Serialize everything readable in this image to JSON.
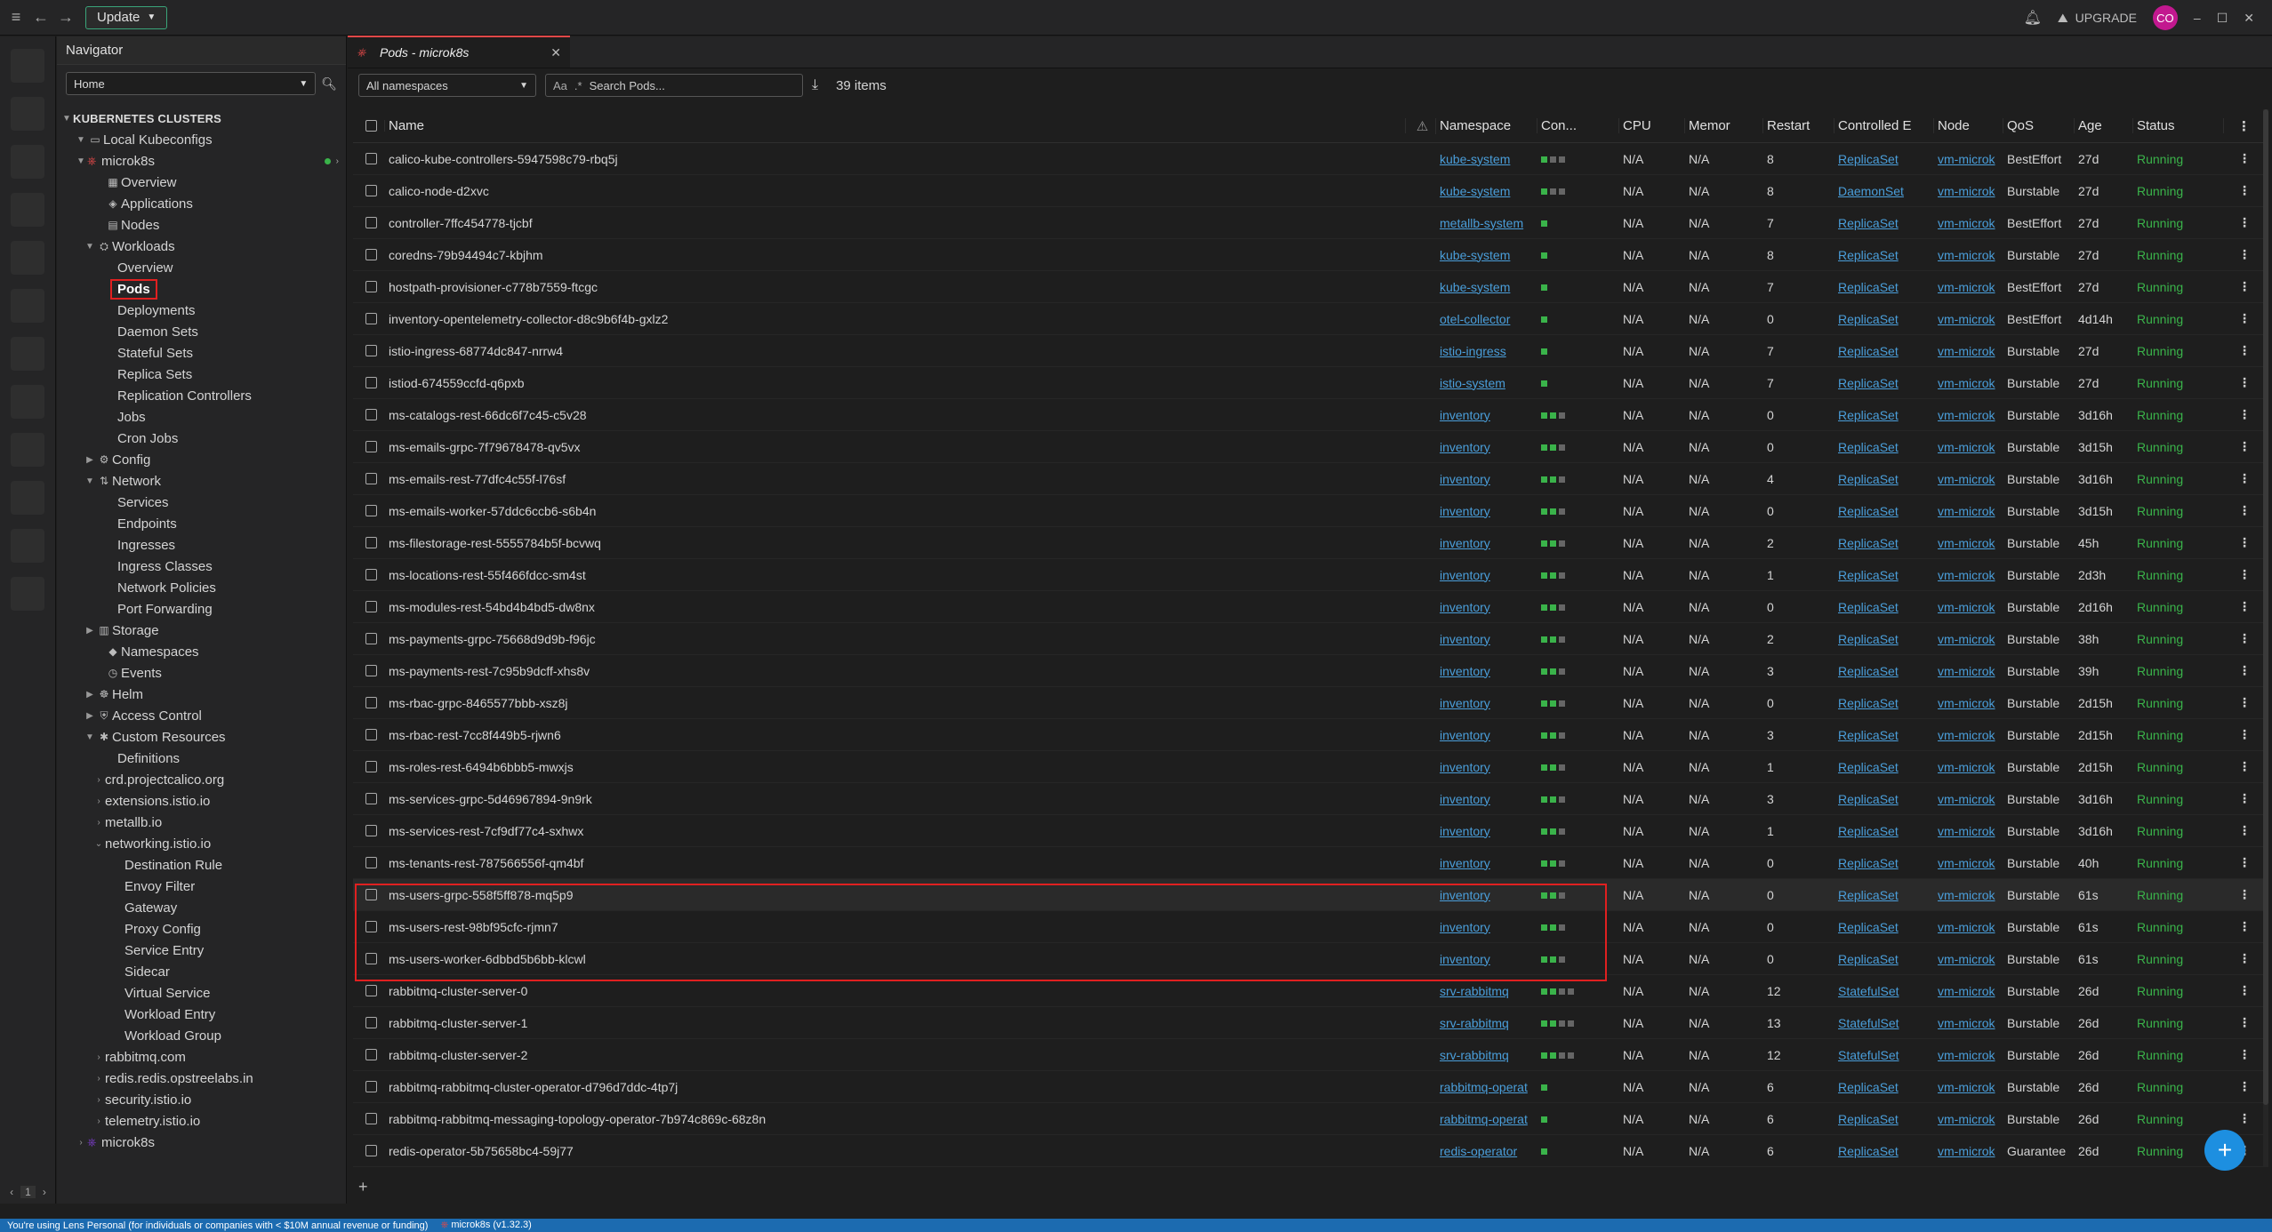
{
  "topbar": {
    "update_label": "Update",
    "upgrade_label": "UPGRADE",
    "avatar_initials": "CO"
  },
  "hotbar": {
    "page": "1"
  },
  "navigator": {
    "title": "Navigator",
    "select_value": "Home",
    "clusters_header": "KUBERNETES CLUSTERS",
    "local_kubeconfigs": "Local Kubeconfigs",
    "cluster": "microk8s",
    "items": {
      "overview": "Overview",
      "applications": "Applications",
      "nodes": "Nodes",
      "workloads": "Workloads",
      "w_overview": "Overview",
      "pods": "Pods",
      "deployments": "Deployments",
      "daemon_sets": "Daemon Sets",
      "stateful_sets": "Stateful Sets",
      "replica_sets": "Replica Sets",
      "replication_controllers": "Replication Controllers",
      "jobs": "Jobs",
      "cron_jobs": "Cron Jobs",
      "config": "Config",
      "network": "Network",
      "services": "Services",
      "endpoints": "Endpoints",
      "ingresses": "Ingresses",
      "ingress_classes": "Ingress Classes",
      "network_policies": "Network Policies",
      "port_forwarding": "Port Forwarding",
      "storage": "Storage",
      "namespaces": "Namespaces",
      "events": "Events",
      "helm": "Helm",
      "access_control": "Access Control",
      "custom_resources": "Custom Resources",
      "definitions": "Definitions",
      "crd_calico": "crd.projectcalico.org",
      "extensions_istio": "extensions.istio.io",
      "metallb": "metallb.io",
      "networking_istio": "networking.istio.io",
      "destination_rule": "Destination Rule",
      "envoy_filter": "Envoy Filter",
      "gateway": "Gateway",
      "proxy_config": "Proxy Config",
      "service_entry": "Service Entry",
      "sidecar": "Sidecar",
      "virtual_service": "Virtual Service",
      "workload_entry": "Workload Entry",
      "workload_group": "Workload Group",
      "rabbitmq": "rabbitmq.com",
      "redis": "redis.redis.opstreelabs.in",
      "security_istio": "security.istio.io",
      "telemetry_istio": "telemetry.istio.io",
      "microk8s2": "microk8s"
    }
  },
  "tab": {
    "title": "Pods - microk8s"
  },
  "toolbar": {
    "namespace": "All namespaces",
    "search_placeholder": "Search Pods...",
    "items_count": "39 items",
    "aa": "Aa"
  },
  "table": {
    "headers": {
      "name": "Name",
      "namespace": "Namespace",
      "containers": "Con...",
      "cpu": "CPU",
      "memory": "Memor",
      "restarts": "Restart",
      "controlled_by": "Controlled E",
      "node": "Node",
      "qos": "QoS",
      "age": "Age",
      "status": "Status"
    },
    "rows": [
      {
        "name": "calico-kube-controllers-5947598c79-rbq5j",
        "ns": "kube-system",
        "c": [
          1,
          0,
          0
        ],
        "cpu": "N/A",
        "mem": "N/A",
        "r": "8",
        "ctl": "ReplicaSet",
        "node": "vm-microk",
        "qos": "BestEffort",
        "age": "27d",
        "status": "Running"
      },
      {
        "name": "calico-node-d2xvc",
        "ns": "kube-system",
        "c": [
          1,
          0,
          0
        ],
        "cpu": "N/A",
        "mem": "N/A",
        "r": "8",
        "ctl": "DaemonSet",
        "node": "vm-microk",
        "qos": "Burstable",
        "age": "27d",
        "status": "Running"
      },
      {
        "name": "controller-7ffc454778-tjcbf",
        "ns": "metallb-system",
        "c": [
          1
        ],
        "cpu": "N/A",
        "mem": "N/A",
        "r": "7",
        "ctl": "ReplicaSet",
        "node": "vm-microk",
        "qos": "BestEffort",
        "age": "27d",
        "status": "Running"
      },
      {
        "name": "coredns-79b94494c7-kbjhm",
        "ns": "kube-system",
        "c": [
          1
        ],
        "cpu": "N/A",
        "mem": "N/A",
        "r": "8",
        "ctl": "ReplicaSet",
        "node": "vm-microk",
        "qos": "Burstable",
        "age": "27d",
        "status": "Running"
      },
      {
        "name": "hostpath-provisioner-c778b7559-ftcgc",
        "ns": "kube-system",
        "c": [
          1
        ],
        "cpu": "N/A",
        "mem": "N/A",
        "r": "7",
        "ctl": "ReplicaSet",
        "node": "vm-microk",
        "qos": "BestEffort",
        "age": "27d",
        "status": "Running"
      },
      {
        "name": "inventory-opentelemetry-collector-d8c9b6f4b-gxlz2",
        "ns": "otel-collector",
        "c": [
          1
        ],
        "cpu": "N/A",
        "mem": "N/A",
        "r": "0",
        "ctl": "ReplicaSet",
        "node": "vm-microk",
        "qos": "BestEffort",
        "age": "4d14h",
        "status": "Running"
      },
      {
        "name": "istio-ingress-68774dc847-nrrw4",
        "ns": "istio-ingress",
        "c": [
          1
        ],
        "cpu": "N/A",
        "mem": "N/A",
        "r": "7",
        "ctl": "ReplicaSet",
        "node": "vm-microk",
        "qos": "Burstable",
        "age": "27d",
        "status": "Running"
      },
      {
        "name": "istiod-674559ccfd-q6pxb",
        "ns": "istio-system",
        "c": [
          1
        ],
        "cpu": "N/A",
        "mem": "N/A",
        "r": "7",
        "ctl": "ReplicaSet",
        "node": "vm-microk",
        "qos": "Burstable",
        "age": "27d",
        "status": "Running"
      },
      {
        "name": "ms-catalogs-rest-66dc6f7c45-c5v28",
        "ns": "inventory",
        "c": [
          1,
          1,
          0
        ],
        "cpu": "N/A",
        "mem": "N/A",
        "r": "0",
        "ctl": "ReplicaSet",
        "node": "vm-microk",
        "qos": "Burstable",
        "age": "3d16h",
        "status": "Running"
      },
      {
        "name": "ms-emails-grpc-7f79678478-qv5vx",
        "ns": "inventory",
        "c": [
          1,
          1,
          0
        ],
        "cpu": "N/A",
        "mem": "N/A",
        "r": "0",
        "ctl": "ReplicaSet",
        "node": "vm-microk",
        "qos": "Burstable",
        "age": "3d15h",
        "status": "Running"
      },
      {
        "name": "ms-emails-rest-77dfc4c55f-l76sf",
        "ns": "inventory",
        "c": [
          1,
          1,
          0
        ],
        "cpu": "N/A",
        "mem": "N/A",
        "r": "4",
        "ctl": "ReplicaSet",
        "node": "vm-microk",
        "qos": "Burstable",
        "age": "3d16h",
        "status": "Running"
      },
      {
        "name": "ms-emails-worker-57ddc6ccb6-s6b4n",
        "ns": "inventory",
        "c": [
          1,
          1,
          0
        ],
        "cpu": "N/A",
        "mem": "N/A",
        "r": "0",
        "ctl": "ReplicaSet",
        "node": "vm-microk",
        "qos": "Burstable",
        "age": "3d15h",
        "status": "Running"
      },
      {
        "name": "ms-filestorage-rest-5555784b5f-bcvwq",
        "ns": "inventory",
        "c": [
          1,
          1,
          0
        ],
        "cpu": "N/A",
        "mem": "N/A",
        "r": "2",
        "ctl": "ReplicaSet",
        "node": "vm-microk",
        "qos": "Burstable",
        "age": "45h",
        "status": "Running"
      },
      {
        "name": "ms-locations-rest-55f466fdcc-sm4st",
        "ns": "inventory",
        "c": [
          1,
          1,
          0
        ],
        "cpu": "N/A",
        "mem": "N/A",
        "r": "1",
        "ctl": "ReplicaSet",
        "node": "vm-microk",
        "qos": "Burstable",
        "age": "2d3h",
        "status": "Running"
      },
      {
        "name": "ms-modules-rest-54bd4b4bd5-dw8nx",
        "ns": "inventory",
        "c": [
          1,
          1,
          0
        ],
        "cpu": "N/A",
        "mem": "N/A",
        "r": "0",
        "ctl": "ReplicaSet",
        "node": "vm-microk",
        "qos": "Burstable",
        "age": "2d16h",
        "status": "Running"
      },
      {
        "name": "ms-payments-grpc-75668d9d9b-f96jc",
        "ns": "inventory",
        "c": [
          1,
          1,
          0
        ],
        "cpu": "N/A",
        "mem": "N/A",
        "r": "2",
        "ctl": "ReplicaSet",
        "node": "vm-microk",
        "qos": "Burstable",
        "age": "38h",
        "status": "Running"
      },
      {
        "name": "ms-payments-rest-7c95b9dcff-xhs8v",
        "ns": "inventory",
        "c": [
          1,
          1,
          0
        ],
        "cpu": "N/A",
        "mem": "N/A",
        "r": "3",
        "ctl": "ReplicaSet",
        "node": "vm-microk",
        "qos": "Burstable",
        "age": "39h",
        "status": "Running"
      },
      {
        "name": "ms-rbac-grpc-8465577bbb-xsz8j",
        "ns": "inventory",
        "c": [
          1,
          1,
          0
        ],
        "cpu": "N/A",
        "mem": "N/A",
        "r": "0",
        "ctl": "ReplicaSet",
        "node": "vm-microk",
        "qos": "Burstable",
        "age": "2d15h",
        "status": "Running"
      },
      {
        "name": "ms-rbac-rest-7cc8f449b5-rjwn6",
        "ns": "inventory",
        "c": [
          1,
          1,
          0
        ],
        "cpu": "N/A",
        "mem": "N/A",
        "r": "3",
        "ctl": "ReplicaSet",
        "node": "vm-microk",
        "qos": "Burstable",
        "age": "2d15h",
        "status": "Running"
      },
      {
        "name": "ms-roles-rest-6494b6bbb5-mwxjs",
        "ns": "inventory",
        "c": [
          1,
          1,
          0
        ],
        "cpu": "N/A",
        "mem": "N/A",
        "r": "1",
        "ctl": "ReplicaSet",
        "node": "vm-microk",
        "qos": "Burstable",
        "age": "2d15h",
        "status": "Running"
      },
      {
        "name": "ms-services-grpc-5d46967894-9n9rk",
        "ns": "inventory",
        "c": [
          1,
          1,
          0
        ],
        "cpu": "N/A",
        "mem": "N/A",
        "r": "3",
        "ctl": "ReplicaSet",
        "node": "vm-microk",
        "qos": "Burstable",
        "age": "3d16h",
        "status": "Running"
      },
      {
        "name": "ms-services-rest-7cf9df77c4-sxhwx",
        "ns": "inventory",
        "c": [
          1,
          1,
          0
        ],
        "cpu": "N/A",
        "mem": "N/A",
        "r": "1",
        "ctl": "ReplicaSet",
        "node": "vm-microk",
        "qos": "Burstable",
        "age": "3d16h",
        "status": "Running"
      },
      {
        "name": "ms-tenants-rest-787566556f-qm4bf",
        "ns": "inventory",
        "c": [
          1,
          1,
          0
        ],
        "cpu": "N/A",
        "mem": "N/A",
        "r": "0",
        "ctl": "ReplicaSet",
        "node": "vm-microk",
        "qos": "Burstable",
        "age": "40h",
        "status": "Running"
      },
      {
        "name": "ms-users-grpc-558f5ff878-mq5p9",
        "ns": "inventory",
        "c": [
          1,
          1,
          0
        ],
        "cpu": "N/A",
        "mem": "N/A",
        "r": "0",
        "ctl": "ReplicaSet",
        "node": "vm-microk",
        "qos": "Burstable",
        "age": "61s",
        "status": "Running",
        "hl": true
      },
      {
        "name": "ms-users-rest-98bf95cfc-rjmn7",
        "ns": "inventory",
        "c": [
          1,
          1,
          0
        ],
        "cpu": "N/A",
        "mem": "N/A",
        "r": "0",
        "ctl": "ReplicaSet",
        "node": "vm-microk",
        "qos": "Burstable",
        "age": "61s",
        "status": "Running"
      },
      {
        "name": "ms-users-worker-6dbbd5b6bb-klcwl",
        "ns": "inventory",
        "c": [
          1,
          1,
          0
        ],
        "cpu": "N/A",
        "mem": "N/A",
        "r": "0",
        "ctl": "ReplicaSet",
        "node": "vm-microk",
        "qos": "Burstable",
        "age": "61s",
        "status": "Running"
      },
      {
        "name": "rabbitmq-cluster-server-0",
        "ns": "srv-rabbitmq",
        "c": [
          1,
          1,
          0,
          0
        ],
        "cpu": "N/A",
        "mem": "N/A",
        "r": "12",
        "ctl": "StatefulSet",
        "node": "vm-microk",
        "qos": "Burstable",
        "age": "26d",
        "status": "Running"
      },
      {
        "name": "rabbitmq-cluster-server-1",
        "ns": "srv-rabbitmq",
        "c": [
          1,
          1,
          0,
          0
        ],
        "cpu": "N/A",
        "mem": "N/A",
        "r": "13",
        "ctl": "StatefulSet",
        "node": "vm-microk",
        "qos": "Burstable",
        "age": "26d",
        "status": "Running"
      },
      {
        "name": "rabbitmq-cluster-server-2",
        "ns": "srv-rabbitmq",
        "c": [
          1,
          1,
          0,
          0
        ],
        "cpu": "N/A",
        "mem": "N/A",
        "r": "12",
        "ctl": "StatefulSet",
        "node": "vm-microk",
        "qos": "Burstable",
        "age": "26d",
        "status": "Running"
      },
      {
        "name": "rabbitmq-rabbitmq-cluster-operator-d796d7ddc-4tp7j",
        "ns": "rabbitmq-operat",
        "c": [
          1
        ],
        "cpu": "N/A",
        "mem": "N/A",
        "r": "6",
        "ctl": "ReplicaSet",
        "node": "vm-microk",
        "qos": "Burstable",
        "age": "26d",
        "status": "Running"
      },
      {
        "name": "rabbitmq-rabbitmq-messaging-topology-operator-7b974c869c-68z8n",
        "ns": "rabbitmq-operat",
        "c": [
          1
        ],
        "cpu": "N/A",
        "mem": "N/A",
        "r": "6",
        "ctl": "ReplicaSet",
        "node": "vm-microk",
        "qos": "Burstable",
        "age": "26d",
        "status": "Running"
      },
      {
        "name": "redis-operator-5b75658bc4-59j77",
        "ns": "redis-operator",
        "c": [
          1
        ],
        "cpu": "N/A",
        "mem": "N/A",
        "r": "6",
        "ctl": "ReplicaSet",
        "node": "vm-microk",
        "qos": "Guarantee",
        "age": "26d",
        "status": "Running"
      }
    ]
  },
  "statusbar": {
    "license": "You're using Lens Personal (for individuals or companies with < $10M annual revenue or funding)",
    "cluster": "microk8s (v1.32.3)"
  },
  "colors": {
    "accent": "#3ab34a",
    "link": "#4a9eda",
    "highlight": "#e02020",
    "status_bar": "#1c6bb0"
  }
}
